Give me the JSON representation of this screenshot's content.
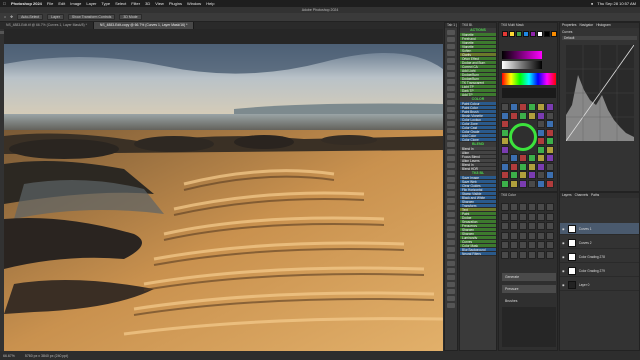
{
  "menubar": {
    "app": "Photoshop 2024",
    "items": [
      "File",
      "Edit",
      "Image",
      "Layer",
      "Type",
      "Select",
      "Filter",
      "3D",
      "View",
      "Plugins",
      "Window",
      "Help"
    ],
    "clock": "Thu Sep 28 10:57 AM"
  },
  "titlebar": {
    "title": "Adobe Photoshop 2024"
  },
  "options": {
    "auto_select": "Auto-Select",
    "layer": "Layer",
    "show_transform": "Show Transform Controls",
    "mode": "3D Mode"
  },
  "tabs": [
    {
      "label": "NS_4883-Edit.tif @ 66.7% (Curves 1, Layer Mask/8) *"
    },
    {
      "label": "NS_4883-Edit-copy @ 66.7% (Curves 1, Layer Mask/16) *"
    }
  ],
  "status": {
    "zoom": "66.67%",
    "info": "5760 px x 3840 px (240 ppi)"
  },
  "panels": {
    "actions_header": "Tab 1 |",
    "presets_header": "TK8 Bl.",
    "actions_title": "ACTIONS",
    "actions": [
      {
        "label": "Vignette",
        "tone": "green"
      },
      {
        "label": "Freehand",
        "tone": "green"
      },
      {
        "label": "Vignette",
        "tone": "green"
      },
      {
        "label": "Vignette",
        "tone": "green"
      },
      {
        "label": "Soften",
        "tone": "green"
      },
      {
        "label": "Clarity",
        "tone": "olive"
      },
      {
        "label": "Orton Effect",
        "tone": "green"
      },
      {
        "label": "Dodge and Burn",
        "tone": "green"
      },
      {
        "label": "Correct CA",
        "tone": "green"
      },
      {
        "label": "Add Light",
        "tone": "green"
      },
      {
        "label": "Dodge/Burn",
        "tone": "green"
      },
      {
        "label": "Dodge/Burn",
        "tone": "green"
      },
      {
        "label": "TK Transparent",
        "tone": "green"
      },
      {
        "label": "Light TP",
        "tone": "green"
      },
      {
        "label": "Dark TP",
        "tone": "green"
      },
      {
        "label": "Add TP",
        "tone": "green"
      }
    ],
    "color_title": "COLOR",
    "color_items": [
      {
        "label": "Paint Colour",
        "tone": "blue"
      },
      {
        "label": "Paint Color",
        "tone": "blue"
      },
      {
        "label": "Paint Brush",
        "tone": "blue"
      },
      {
        "label": "Brush Vignette",
        "tone": "blue"
      },
      {
        "label": "Color Lookup",
        "tone": "blue"
      },
      {
        "label": "Color Zone",
        "tone": "blue"
      },
      {
        "label": "Color Cast",
        "tone": "blue"
      },
      {
        "label": "Color Grade",
        "tone": "blue"
      },
      {
        "label": "Add Color",
        "tone": "blue"
      },
      {
        "label": "Color Clone",
        "tone": "blue"
      }
    ],
    "blend_title": "BLEND",
    "blend_items": [
      {
        "label": "Blend In",
        "tone": "dark"
      },
      {
        "label": "Align",
        "tone": "dark"
      },
      {
        "label": "Focus Blend",
        "tone": "dark"
      },
      {
        "label": "Align Layers",
        "tone": "dark"
      },
      {
        "label": "Blend In",
        "tone": "dark"
      },
      {
        "label": "Blend HDR",
        "tone": "dark"
      }
    ],
    "misc_title": "TK8 BL",
    "misc_items": [
      {
        "label": "Save Image",
        "tone": "blue"
      },
      {
        "label": "Save Web",
        "tone": "blue"
      },
      {
        "label": "Clear Guides",
        "tone": "blue"
      },
      {
        "label": "Flip Horizontal",
        "tone": "blue"
      },
      {
        "label": "Stamp Visible",
        "tone": "blue"
      },
      {
        "label": "Black and White",
        "tone": "blue"
      },
      {
        "label": "Sharpen",
        "tone": "blue"
      },
      {
        "label": "Transform",
        "tone": "blue"
      },
      {
        "label": "Text",
        "tone": "olive"
      },
      {
        "label": "Paint",
        "tone": "green"
      },
      {
        "label": "Dodge",
        "tone": "green"
      },
      {
        "label": "Separation",
        "tone": "green"
      },
      {
        "label": "Frequency",
        "tone": "green"
      },
      {
        "label": "Sharpen",
        "tone": "green"
      },
      {
        "label": "Sharpen",
        "tone": "green"
      },
      {
        "label": "Luminosity",
        "tone": "green"
      },
      {
        "label": "Curves",
        "tone": "green"
      },
      {
        "label": "Color Mask",
        "tone": "green"
      },
      {
        "label": "Blur Background",
        "tone": "blue"
      },
      {
        "label": "Neural Filters",
        "tone": "blue"
      }
    ],
    "color_panel_header": "TK8 Multi Mask",
    "tool_panel_header": "TK8 Color",
    "properties_header": "Properties",
    "properties_tabs": [
      "Properties",
      "Navigator",
      "Histogram"
    ],
    "properties_sub": "Curves",
    "properties_preset": "Default",
    "layers_header": "Layers",
    "layers_tabs": [
      "Layers",
      "Channels",
      "Paths"
    ],
    "layers": [
      {
        "name": "Curves 1",
        "selected": true
      },
      {
        "name": "Curves 2",
        "selected": false
      },
      {
        "name": "Color Grading 278",
        "selected": false
      },
      {
        "name": "Color Grading 279",
        "selected": false
      },
      {
        "name": "Layer 0",
        "selected": false
      }
    ],
    "generate_label": "Generate",
    "pressure_label": "Pressure",
    "brush_settings": "Brushes",
    "swatch_colors": [
      "#e53935",
      "#fdd835",
      "#43a047",
      "#1e88e5",
      "#8e24aa",
      "#ffffff",
      "#000000",
      "#fb8c00"
    ]
  }
}
